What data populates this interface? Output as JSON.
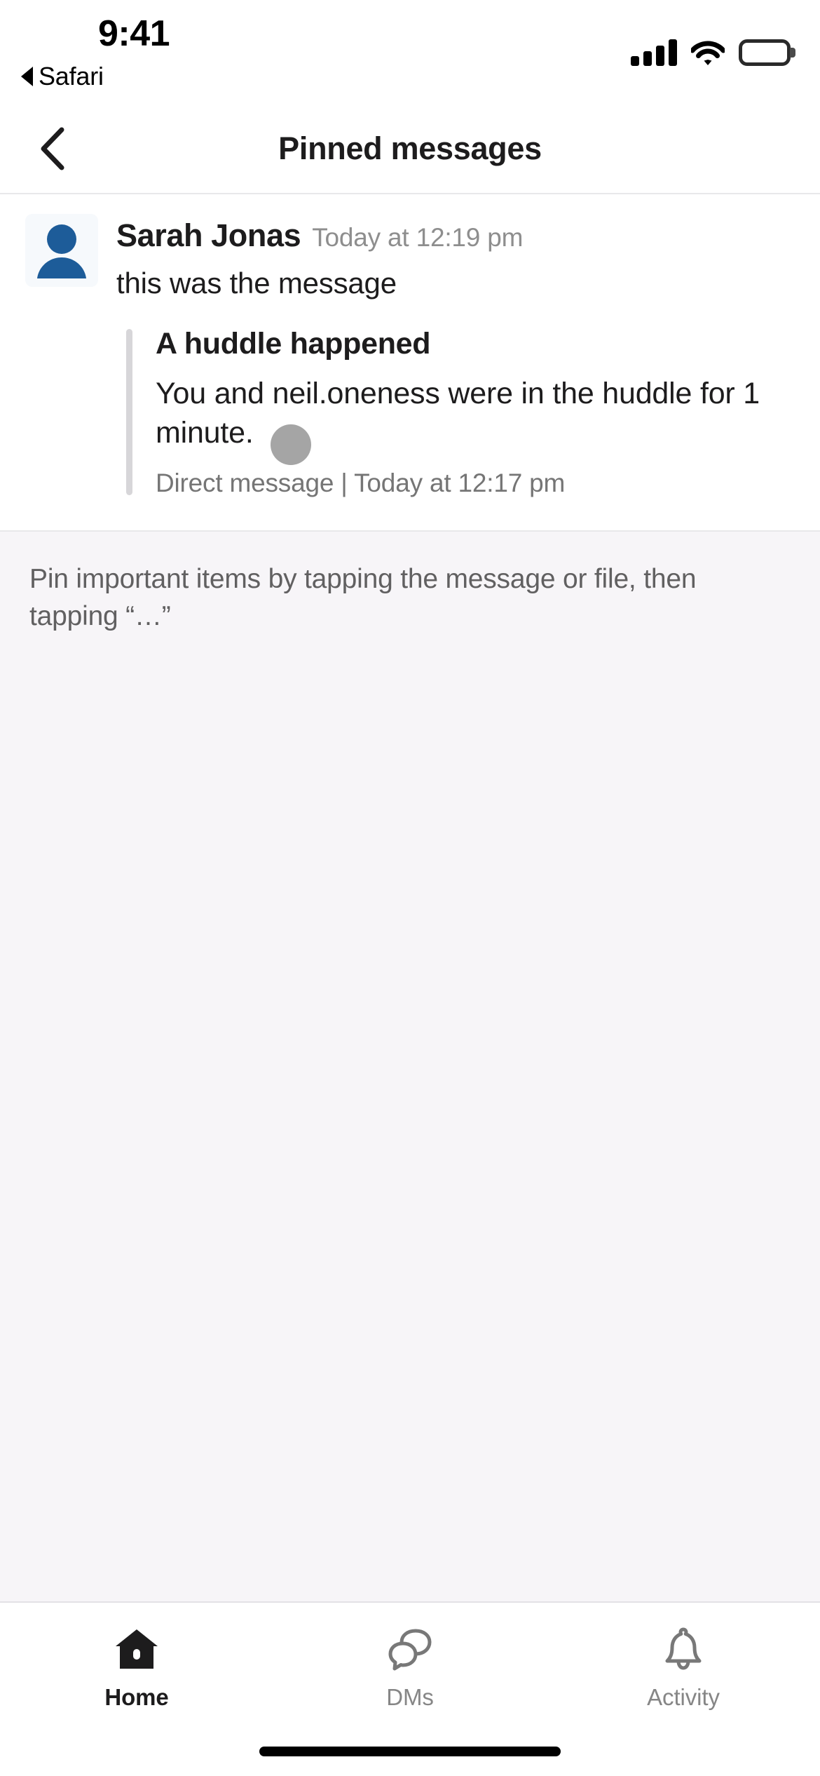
{
  "status_bar": {
    "time": "9:41",
    "back_app_label": "Safari",
    "signal_icon": "cellular-signal-icon",
    "wifi_icon": "wifi-icon",
    "battery_icon": "battery-full-icon"
  },
  "header": {
    "title": "Pinned messages",
    "back_icon": "chevron-left-icon"
  },
  "pinned_message": {
    "avatar_icon": "user-avatar-icon",
    "author": "Sarah Jonas",
    "timestamp": "Today at 12:19 pm",
    "body": "this was the message",
    "attachment": {
      "title": "A huddle happened",
      "text": "You and neil.oneness were in the huddle for 1 minute.",
      "meta": "Direct message | Today at 12:17 pm"
    }
  },
  "hint": {
    "text": "Pin important items by tapping the message or file, then tapping “…”"
  },
  "tab_bar": {
    "tabs": [
      {
        "label": "Home",
        "icon": "home-icon",
        "active": true
      },
      {
        "label": "DMs",
        "icon": "speech-bubbles-icon",
        "active": false
      },
      {
        "label": "Activity",
        "icon": "bell-icon",
        "active": false
      }
    ]
  },
  "colors": {
    "avatar_blue": "#1d5c99",
    "background": "#f7f5f8",
    "card": "#ffffff",
    "text_primary": "#1d1c1d",
    "text_secondary": "#868686",
    "quote_bar": "#d7d6d9",
    "touch_indicator": "#828282"
  }
}
